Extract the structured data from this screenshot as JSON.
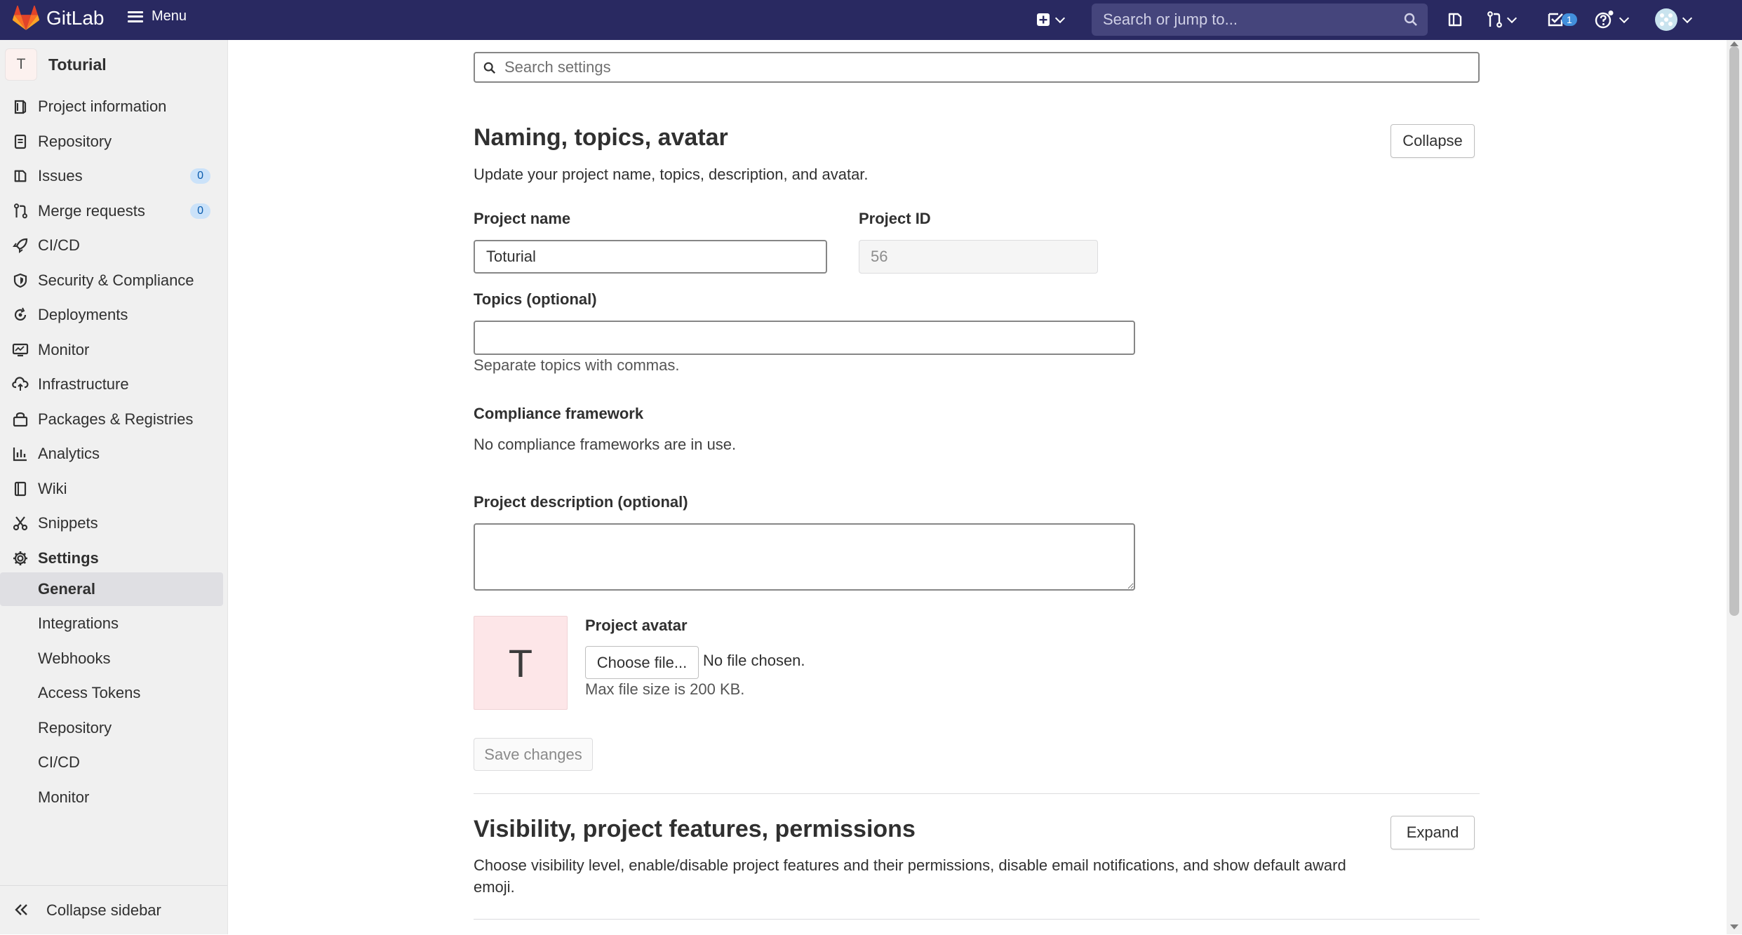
{
  "topbar": {
    "brand": "GitLab",
    "menu_label": "Menu",
    "search_placeholder": "Search or jump to...",
    "todo_count": "1",
    "colors": {
      "bar": "#292961",
      "logo": "#e24329"
    },
    "icons": [
      "plus-square-icon",
      "issues-icon",
      "merge-request-icon",
      "todo-icon",
      "help-icon",
      "user-avatar-icon"
    ]
  },
  "sidebar": {
    "project_initial": "T",
    "project_name": "Toturial",
    "items": [
      {
        "label": "Project information",
        "icon": "project-icon"
      },
      {
        "label": "Repository",
        "icon": "doc-text-icon"
      },
      {
        "label": "Issues",
        "icon": "issues-icon",
        "badge": "0"
      },
      {
        "label": "Merge requests",
        "icon": "merge-request-icon",
        "badge": "0"
      },
      {
        "label": "CI/CD",
        "icon": "rocket-icon"
      },
      {
        "label": "Security & Compliance",
        "icon": "shield-icon"
      },
      {
        "label": "Deployments",
        "icon": "deployments-icon"
      },
      {
        "label": "Monitor",
        "icon": "monitor-icon"
      },
      {
        "label": "Infrastructure",
        "icon": "cloud-icon"
      },
      {
        "label": "Packages & Registries",
        "icon": "package-icon"
      },
      {
        "label": "Analytics",
        "icon": "chart-icon"
      },
      {
        "label": "Wiki",
        "icon": "book-icon"
      },
      {
        "label": "Snippets",
        "icon": "snippet-icon"
      },
      {
        "label": "Settings",
        "icon": "gear-icon"
      }
    ],
    "settings_sub": [
      "General",
      "Integrations",
      "Webhooks",
      "Access Tokens",
      "Repository",
      "CI/CD",
      "Monitor"
    ],
    "collapse_label": "Collapse sidebar"
  },
  "main": {
    "search_placeholder": "Search settings",
    "section1": {
      "title": "Naming, topics, avatar",
      "description": "Update your project name, topics, description, and avatar.",
      "collapse_label": "Collapse",
      "project_name_label": "Project name",
      "project_name_value": "Toturial",
      "project_id_label": "Project ID",
      "project_id_value": "56",
      "topics_label": "Topics (optional)",
      "topics_value": "",
      "topics_help": "Separate topics with commas.",
      "compliance_label": "Compliance framework",
      "compliance_text": "No compliance frameworks are in use.",
      "description_label": "Project description (optional)",
      "description_value": "",
      "avatar_initial": "T",
      "avatar_label": "Project avatar",
      "choose_file_label": "Choose file...",
      "no_file_text": "No file chosen.",
      "max_size_text": "Max file size is 200 KB.",
      "save_label": "Save changes"
    },
    "section2": {
      "title": "Visibility, project features, permissions",
      "description": "Choose visibility level, enable/disable project features and their permissions, disable email notifications, and show default award emoji.",
      "expand_label": "Expand"
    }
  }
}
